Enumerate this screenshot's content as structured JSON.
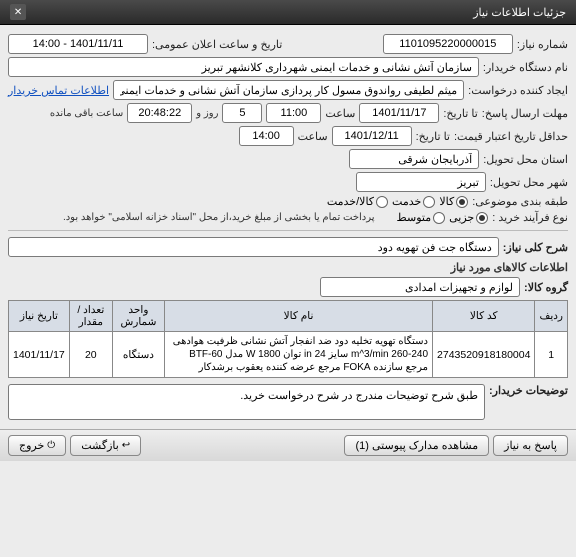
{
  "titlebar": {
    "title": "جزئیات اطلاعات نیاز"
  },
  "labels": {
    "need_no": "شماره نیاز:",
    "announce_dt": "تاریخ و ساعت اعلان عمومی:",
    "buyer": "نام دستگاه خریدار:",
    "requester": "ایجاد کننده درخواست:",
    "contact_link": "اطلاعات تماس خریدار",
    "deadline": "مهلت ارسال پاسخ:",
    "to": "تا تاریخ:",
    "time_lbl": "ساعت",
    "days_left_suffix": "روز و",
    "days_left_tail": "ساعت باقی مانده",
    "quote_valid": "حداقل تاریخ اعتبار قیمت:",
    "province": "استان محل تحویل:",
    "city": "شهر محل تحویل:",
    "category": "طبقه بندی موضوعی:",
    "buy_type": "نوع فرآیند خرید :",
    "pay_note": "پرداخت تمام یا بخشی از مبلغ خرید،از محل \"اسناد خزانه اسلامی\" خواهد بود.",
    "need_title": "شرح کلی نیاز:",
    "items_section": "اطلاعات کالاهای مورد نیاز",
    "goods_group": "گروه کالا:",
    "buyer_notes": "توضیحات خریدار:"
  },
  "values": {
    "need_no": "1101095220000015",
    "announce_dt": "1401/11/11 - 14:00",
    "buyer": "سازمان آتش نشانی و خدمات ایمنی شهرداری کلانشهر تبریز",
    "requester": "میثم لطیفی رواندوق مسول کار پردازی سازمان آتش نشانی و خدمات ایمنی شه",
    "deadline_date": "1401/11/17",
    "deadline_time": "11:00",
    "days_left": "5",
    "time_left": "20:48:22",
    "quote_date": "1401/12/11",
    "quote_time": "14:00",
    "province": "آذربایجان شرقی",
    "city": "تبریز",
    "need_title": "دستگاه جت فن تهویه دود",
    "goods_group": "لوازم و تجهیزات امدادی",
    "buyer_notes": "طبق شرح توضیحات مندرج در شرح درخواست خرید."
  },
  "radios": {
    "category": [
      {
        "label": "کالا",
        "selected": true
      },
      {
        "label": "خدمت",
        "selected": false
      },
      {
        "label": "کالا/خدمت",
        "selected": false
      }
    ],
    "buy_type": [
      {
        "label": "جزیی",
        "selected": true
      },
      {
        "label": "متوسط",
        "selected": false
      }
    ]
  },
  "table": {
    "headers": [
      "ردیف",
      "کد کالا",
      "نام کالا",
      "واحد شمارش",
      "تعداد / مقدار",
      "تاریخ نیاز"
    ],
    "rows": [
      {
        "idx": "1",
        "code": "2743520918180004",
        "name": "دستگاه تهویه تخلیه دود ضد انفجار آتش نشانی ظرفیت هوادهی 240-260 m^3/min سایز in 24 توان W 1800 مدل BTF-60 مرجع سازنده FOKA مرجع عرضه کننده یعقوب برشدکار",
        "unit": "دستگاه",
        "qty": "20",
        "date": "1401/11/17"
      }
    ]
  },
  "footer": {
    "reply": "پاسخ به نیاز",
    "attachments": "مشاهده مدارک پیوستی (1)",
    "back": "بازگشت",
    "exit": "خروج"
  }
}
